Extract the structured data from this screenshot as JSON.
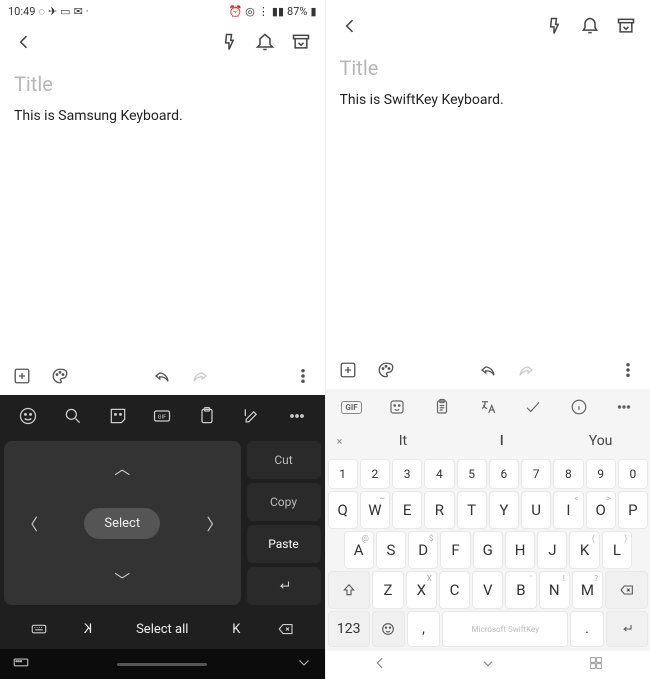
{
  "left": {
    "status": {
      "time": "10:49",
      "battery": "87%"
    },
    "note": {
      "title_placeholder": "Title",
      "body": "This is Samsung Keyboard."
    },
    "kb": {
      "select": "Select",
      "cut": "Cut",
      "copy": "Copy",
      "paste": "Paste",
      "select_all": "Select all",
      "prev_word": "K",
      "next_word": "K"
    }
  },
  "right": {
    "note": {
      "title_placeholder": "Title",
      "body": "This is SwiftKey Keyboard."
    },
    "kb": {
      "suggestions": {
        "left_small": "×",
        "s1": "It",
        "s2": "I",
        "s3": "You"
      },
      "num_row": [
        "1",
        "2",
        "3",
        "4",
        "5",
        "6",
        "7",
        "8",
        "9",
        "0"
      ],
      "row1": [
        "Q",
        "W",
        "E",
        "R",
        "T",
        "Y",
        "U",
        "I",
        "O",
        "P"
      ],
      "row1_sub": [
        "",
        "~",
        "",
        "",
        "",
        "",
        "",
        "<",
        ">",
        ""
      ],
      "row2": [
        "A",
        "S",
        "D",
        "F",
        "G",
        "H",
        "J",
        "K",
        "L"
      ],
      "row2_sub": [
        "@",
        "",
        "$",
        "",
        "",
        "",
        "",
        "(",
        ")"
      ],
      "row3": [
        "Z",
        "X",
        "C",
        "V",
        "B",
        "N",
        "M"
      ],
      "row3_sub": [
        "",
        "X",
        "",
        "",
        "'",
        "!",
        "?"
      ],
      "mode": "123",
      "space": "Microsoft SwiftKey",
      "comma": ",",
      "period": "."
    }
  }
}
